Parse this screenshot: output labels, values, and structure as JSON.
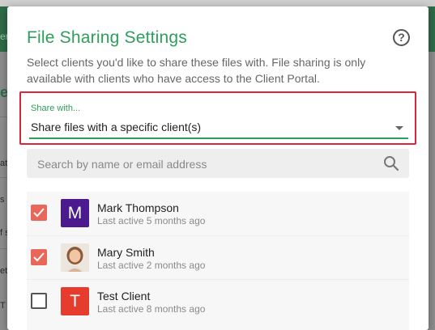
{
  "background": {
    "top_fragment": "er",
    "side_fragments": [
      "e",
      "at",
      "s",
      "f s",
      "et",
      "T"
    ]
  },
  "dialog": {
    "title": "File Sharing Settings",
    "help_icon": "question-circle-icon",
    "help_glyph": "?",
    "description": "Select clients you'd like to share these files with. File sharing is only available with clients who have access to the Client Portal.",
    "share_with": {
      "label": "Share with...",
      "value": "Share files with a specific client(s)"
    },
    "search": {
      "placeholder": "Search by name or email address"
    },
    "clients": [
      {
        "name": "Mark Thompson",
        "last_active": "Last active 5 months ago",
        "checked": true,
        "initial": "M",
        "avatar_color": "#4b1a8f",
        "photo": false
      },
      {
        "name": "Mary Smith",
        "last_active": "Last active 2 months ago",
        "checked": true,
        "initial": "",
        "avatar_color": "#c9a98a",
        "photo": true
      },
      {
        "name": "Test Client",
        "last_active": "Last active 8 months ago",
        "checked": false,
        "initial": "T",
        "avatar_color": "#e63c2e",
        "photo": false
      }
    ]
  },
  "colors": {
    "accent_green": "#2e9e5b",
    "highlight_red": "#d7263d",
    "checkbox_checked": "#e8675a"
  }
}
